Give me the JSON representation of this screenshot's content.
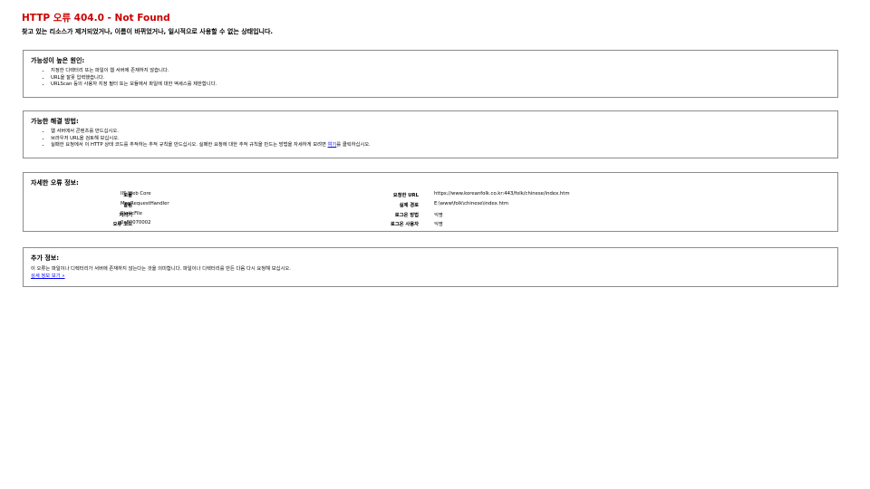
{
  "title": "HTTP 오류 404.0 - Not Found",
  "subtitle": "찾고 있는 리소스가 제거되었거나, 이름이 바뀌었거나, 일시적으로 사용할 수 없는 상태입니다.",
  "causes": {
    "heading": "가능성이 높은 원인:",
    "items": [
      "지정한 디렉터리 또는 파일이 웹 서버에 존재하지 않습니다.",
      "URL을 잘못 입력했습니다.",
      "URLScan 등의 사용자 지정 필터 또는 모듈에서 파일에 대한 액세스를 제한합니다."
    ]
  },
  "solutions": {
    "heading": "가능한 해결 방법:",
    "items": [
      "웹 서버에서 콘텐츠를 만드십시오.",
      "브라우저 URL을 검토해 보십시오.",
      "실패한 요청에서 이 HTTP 상태 코드를 추적하는 추적 규칙을 만드십시오. 실패한 요청에 대한 추적 규칙을 만드는 방법을 자세하게 보려면 "
    ],
    "link_text": "여기",
    "link_suffix": "를 클릭하십시오."
  },
  "details": {
    "heading": "자세한 오류 정보:",
    "left": [
      {
        "label": "모듈",
        "value": "IIS Web Core"
      },
      {
        "label": "알림",
        "value": "MapRequestHandler"
      },
      {
        "label": "처리기",
        "value": "StaticFile"
      },
      {
        "label": "오류 코드",
        "value": "0x80070002"
      }
    ],
    "right": [
      {
        "label": "요청한 URL",
        "value": "https://www.koreanfolk.co.kr:443/folk/chinese/index.htm"
      },
      {
        "label": "실제 경로",
        "value": "E:\\www\\folk\\chinese\\index.htm"
      },
      {
        "label": "로그온 방법",
        "value": "익명"
      },
      {
        "label": "로그온 사용자",
        "value": "익명"
      }
    ]
  },
  "more": {
    "heading": "추가 정보:",
    "text": "이 오류는 파일이나 디렉터리가 서버에 존재하지 않는다는 것을 의미합니다. 파일이나 디렉터리를 만든 다음 다시 요청해 보십시오.",
    "link": "상세 정보 보기 »"
  }
}
